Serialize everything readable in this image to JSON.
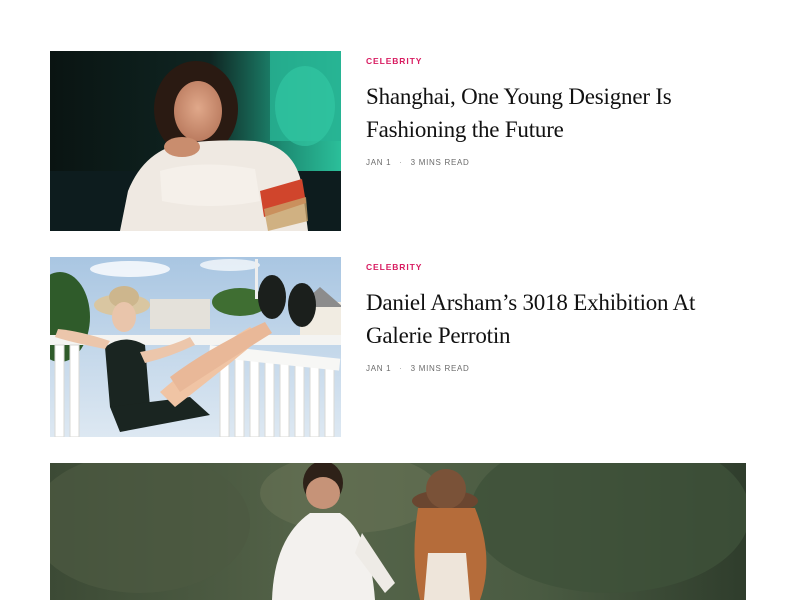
{
  "articles": [
    {
      "category": "Celebrity",
      "title": "Shanghai, One Young Designer Is Fashioning the Future",
      "date": "Jan 1",
      "separator": "·",
      "read_time": "3 Mins Read",
      "image_subject": "woman-in-sweater-photo"
    },
    {
      "category": "Celebrity",
      "title": "Daniel Arsham’s 3018 Exhibition At Galerie Perrotin",
      "date": "Jan 1",
      "separator": "·",
      "read_time": "3 Mins Read",
      "image_subject": "woman-on-balcony-photo"
    }
  ],
  "featured": {
    "image_subject": "couple-walking-in-forest-photo"
  },
  "colors": {
    "accent": "#d81b60",
    "headline": "#111111",
    "meta": "#6b6b6b"
  }
}
